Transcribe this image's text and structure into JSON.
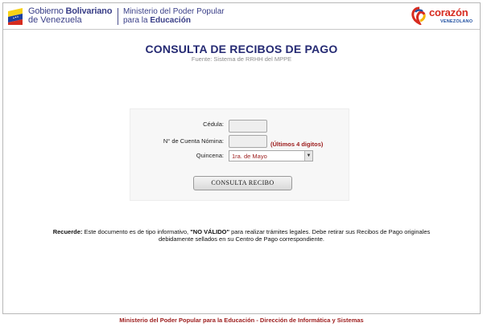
{
  "header": {
    "gobierno_prefix": "Gobierno",
    "gobierno_bold": "Bolivariano",
    "gobierno_line2": "de Venezuela",
    "ministerio_line1": "Ministerio del Poder Popular",
    "ministerio_line2_prefix": "para la",
    "ministerio_line2_bold": "Educación",
    "logo_word": "corazón",
    "logo_sub": "VENEZOLANO"
  },
  "page": {
    "title": "CONSULTA DE RECIBOS DE PAGO",
    "subtitle": "Fuente: Sistema de RRHH del MPPE"
  },
  "form": {
    "cedula_label": "Cédula:",
    "cedula_value": "",
    "cuenta_label": "N° de Cuenta Nómina:",
    "cuenta_value": "",
    "cuenta_hint": "(Últimos 4 digitos)",
    "quincena_label": "Quincena:",
    "quincena_selected": "1ra. de Mayo",
    "submit_label": "CONSULTA RECIBO"
  },
  "notice": {
    "lead": "Recuerde:",
    "text1": "Este documento es de tipo informativo,",
    "emphasis": "\"NO VÁLIDO\"",
    "text2": "para realizar trámites legales. Debe retirar sus Recibos de Pago originales debidamente sellados en su Centro de Pago correspondiente."
  },
  "footer": {
    "text": "Ministerio del Poder Popular para la Educación - Dirección de Informática y Sistemas"
  },
  "colors": {
    "title": "#252a73",
    "accent_red": "#9c1c1c",
    "header_blue": "#3a3f88"
  }
}
